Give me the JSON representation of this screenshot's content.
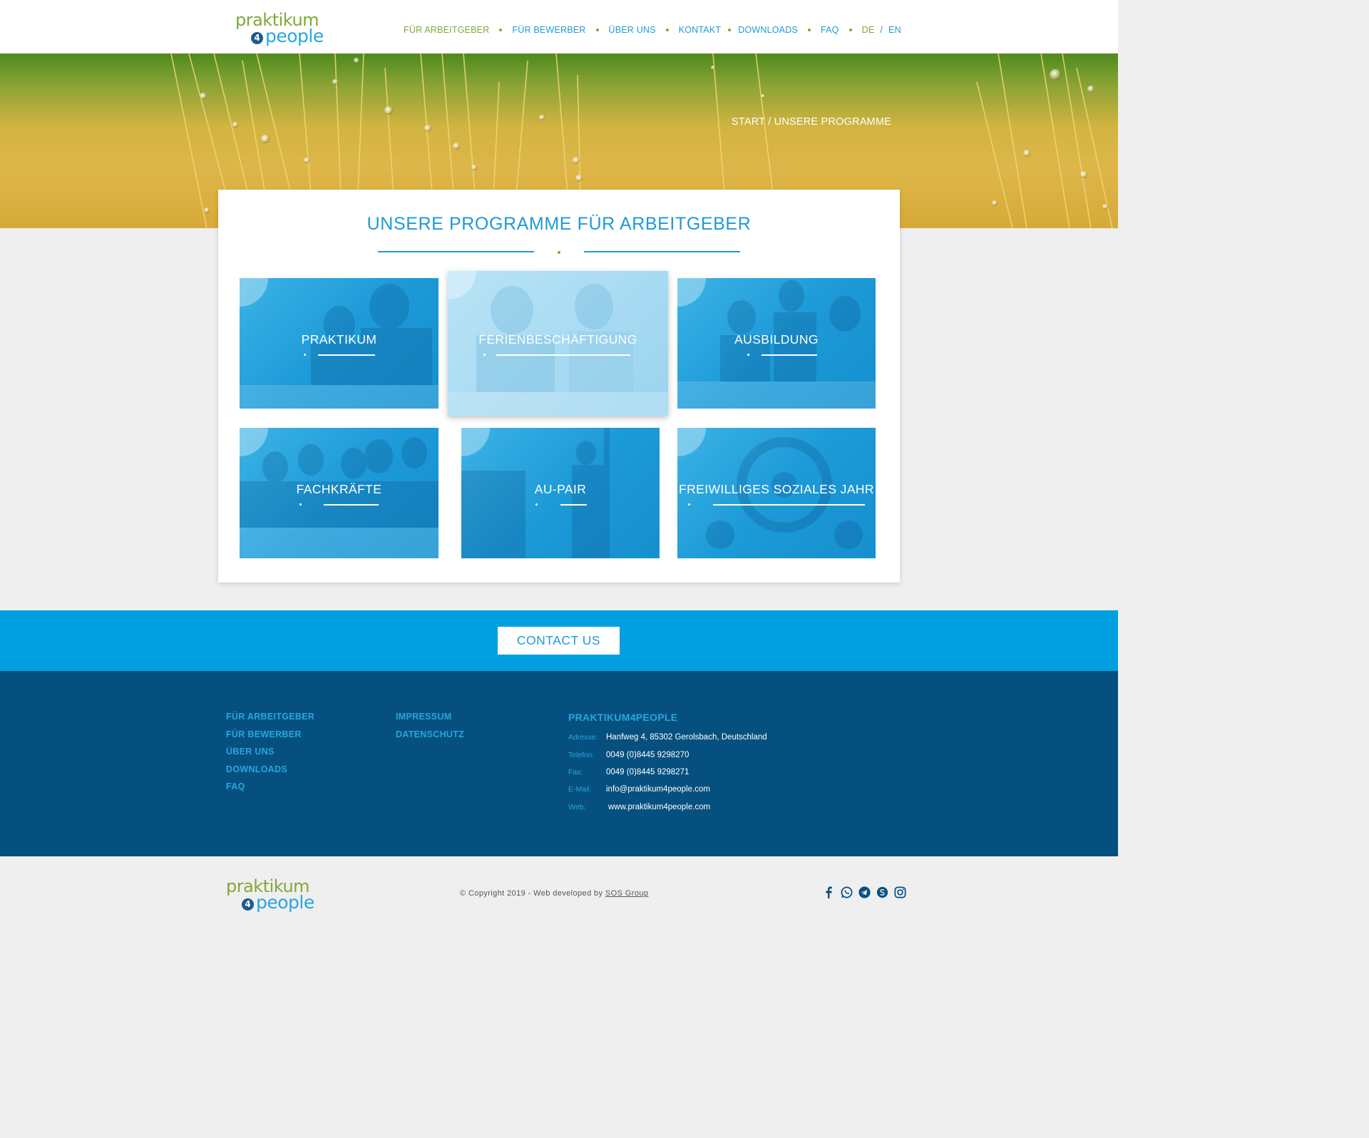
{
  "header": {
    "logo_text_top": "praktikum",
    "logo_four": "4",
    "logo_text_bottom": "people",
    "nav": [
      {
        "label": "FÜR ARBEITGEBER"
      },
      {
        "label": "FÜR BEWERBER"
      },
      {
        "label": "ÜBER UNS"
      },
      {
        "label": "KONTAKT"
      },
      {
        "label": "DOWNLOADS"
      },
      {
        "label": "FAQ"
      }
    ],
    "lang_de": "DE",
    "lang_sep": "/",
    "lang_en": "EN"
  },
  "hero": {
    "breadcrumb": "START / UNSERE PROGRAMME"
  },
  "main": {
    "title": "UNSERE PROGRAMME FÜR ARBEITGEBER",
    "programs": [
      {
        "label": "PRAKTIKUM"
      },
      {
        "label": "FERIENBESCHÄFTIGUNG"
      },
      {
        "label": "AUSBILDUNG"
      },
      {
        "label": "FACHKRÄFTE"
      },
      {
        "label": "AU-PAIR"
      },
      {
        "label": "FREIWILLIGES SOZIALES JAHR"
      }
    ]
  },
  "contact": {
    "button": "CONTACT US"
  },
  "footer": {
    "col1": [
      "FÜR ARBEITGEBER",
      "FÜR BEWERBER",
      "ÜBER UNS",
      "DOWNLOADS",
      "FAQ"
    ],
    "col2": [
      "IMPRESSUM",
      "DATENSCHUTZ"
    ],
    "company": "PRAKTIKUM4PEOPLE",
    "info": [
      {
        "key": "Adresse:",
        "value": "Hanfweg 4, 85302 Gerolsbach, Deutschland"
      },
      {
        "key": "Telefon:",
        "value": "0049 (0)8445 9298270"
      },
      {
        "key": "Fax:",
        "value": "0049 (0)8445 9298271"
      },
      {
        "key": "E-Mail:",
        "value": "info@praktikum4people.com"
      },
      {
        "key": "Web:",
        "value": "www.praktikum4people.com"
      }
    ]
  },
  "bottom": {
    "copyright_prefix": "© Copyright 2019 - Web developed by ",
    "copyright_link": "SOS Group",
    "social_icons": [
      "facebook-icon",
      "whatsapp-icon",
      "telegram-icon",
      "skype-icon",
      "instagram-icon"
    ]
  },
  "colors": {
    "brand_blue": "#1e9ad6",
    "brand_green": "#7fa83a",
    "footer_navy": "#06507f",
    "contact_band": "#00a0e0"
  }
}
